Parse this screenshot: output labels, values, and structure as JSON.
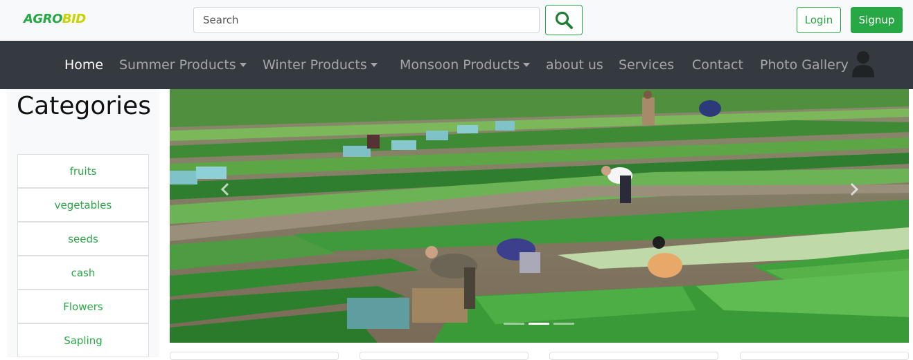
{
  "brand": {
    "logo_part1": "AGRO",
    "logo_part2": "BID"
  },
  "search": {
    "placeholder": "Search",
    "button_icon": "search-icon"
  },
  "auth": {
    "login_label": "Login",
    "signup_label": "Signup"
  },
  "nav": {
    "items": [
      {
        "label": "Home",
        "active": true,
        "dropdown": false
      },
      {
        "label": "Summer Products",
        "active": false,
        "dropdown": true
      },
      {
        "label": "Winter Products",
        "active": false,
        "dropdown": true
      },
      {
        "label": "Monsoon Products",
        "active": false,
        "dropdown": true
      },
      {
        "label": "about us",
        "active": false,
        "dropdown": false
      },
      {
        "label": "Services",
        "active": false,
        "dropdown": false
      },
      {
        "label": "Contact",
        "active": false,
        "dropdown": false
      },
      {
        "label": "Photo Gallery",
        "active": false,
        "dropdown": false
      }
    ],
    "user_icon": "user-icon"
  },
  "sidebar": {
    "title": "Categories",
    "items": [
      {
        "label": "fruits"
      },
      {
        "label": "vegetables"
      },
      {
        "label": "seeds"
      },
      {
        "label": "cash"
      },
      {
        "label": "Flowers"
      },
      {
        "label": "Sapling"
      }
    ]
  },
  "carousel": {
    "prev_icon": "chevron-left-icon",
    "next_icon": "chevron-right-icon",
    "slide_count": 3,
    "active_slide": 2
  },
  "colors": {
    "brand_green": "#28a745",
    "brand_yellow": "#c8d400",
    "navbar_bg": "#343a40",
    "topbar_bg": "#f8f9fa"
  }
}
